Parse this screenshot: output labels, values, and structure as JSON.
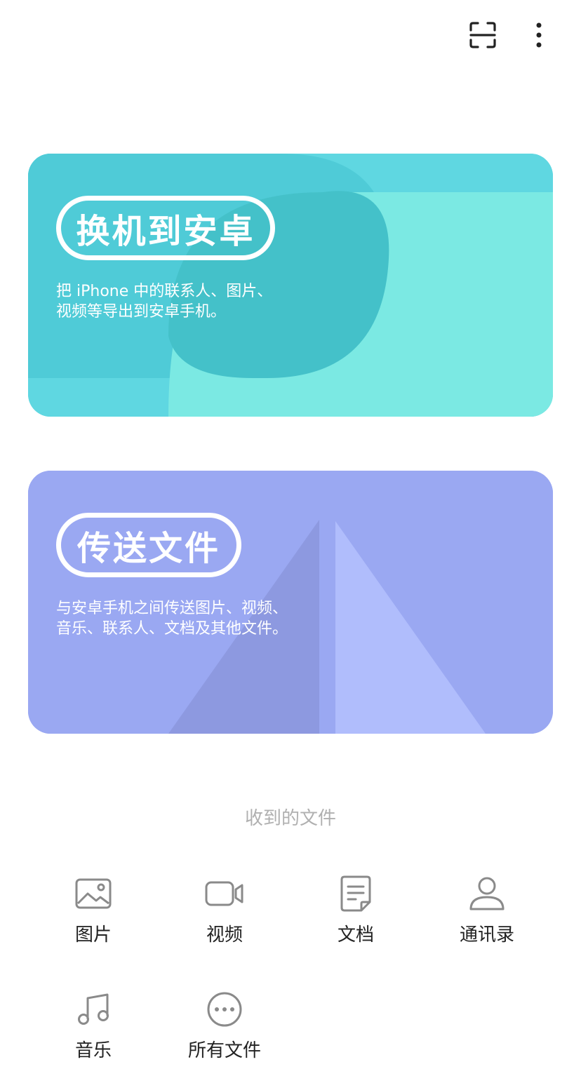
{
  "cards": [
    {
      "title": "换机到安卓",
      "description": "把 iPhone 中的联系人、图片、视频等导出到安卓手机。"
    },
    {
      "title": "传送文件",
      "description": "与安卓手机之间传送图片、视频、音乐、联系人、文档及其他文件。"
    }
  ],
  "received": {
    "title": "收到的文件",
    "categories": [
      {
        "label": "图片",
        "icon": "image-icon"
      },
      {
        "label": "视频",
        "icon": "video-icon"
      },
      {
        "label": "文档",
        "icon": "document-icon"
      },
      {
        "label": "通讯录",
        "icon": "contacts-icon"
      },
      {
        "label": "音乐",
        "icon": "music-icon"
      },
      {
        "label": "所有文件",
        "icon": "more-files-icon"
      }
    ]
  },
  "colors": {
    "switch_card": "#5fd7e1",
    "transfer_card": "#9aa8f2",
    "icon_gray": "#8a8a8a"
  }
}
